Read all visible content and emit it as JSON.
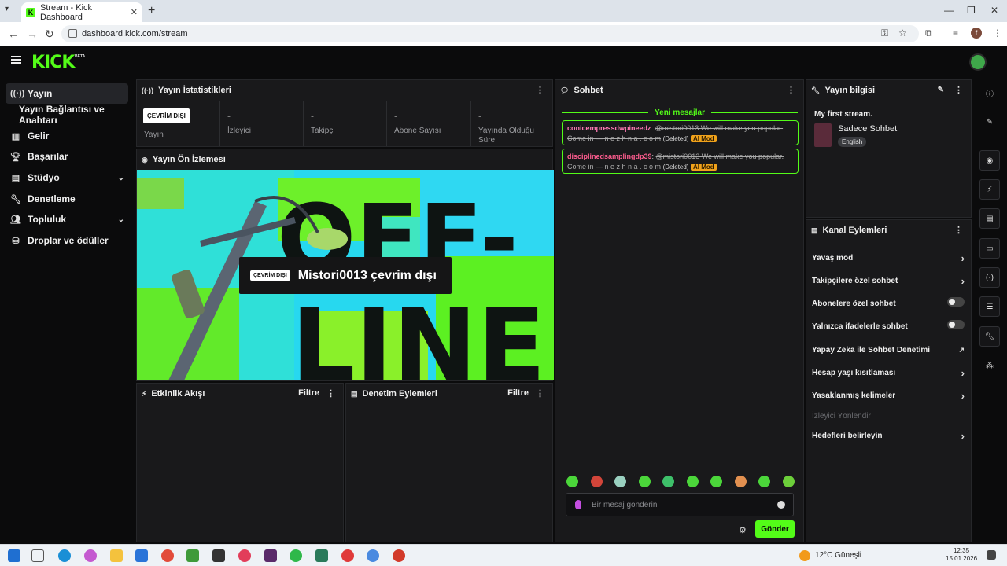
{
  "browser": {
    "tab_title": "Stream - Kick Dashboard",
    "url": "dashboard.kick.com/stream",
    "profile_initial": "f"
  },
  "header": {
    "logo": "KICK",
    "badge": "BETA"
  },
  "sidebar": {
    "items": [
      {
        "label": "Yayın",
        "icon": "broadcast-icon"
      },
      {
        "label": "Yayın Bağlantısı ve Anahtarı",
        "icon": ""
      },
      {
        "label": "Gelir",
        "icon": "chart-icon"
      },
      {
        "label": "Başarılar",
        "icon": "trophy-icon"
      },
      {
        "label": "Stüdyo",
        "icon": "studio-icon"
      },
      {
        "label": "Denetleme",
        "icon": "wrench-icon"
      },
      {
        "label": "Topluluk",
        "icon": "people-icon"
      },
      {
        "label": "Droplar ve ödüller",
        "icon": "gift-icon"
      }
    ]
  },
  "stats": {
    "title": "Yayın İstatistikleri",
    "status_badge": "ÇEVRİM DIŞI",
    "status_label": "Yayın",
    "cells": [
      {
        "value": "-",
        "label": "İzleyici"
      },
      {
        "value": "-",
        "label": "Takipçi"
      },
      {
        "value": "-",
        "label": "Abone Sayısı"
      },
      {
        "value": "-",
        "label": "Yayında Olduğu Süre"
      }
    ]
  },
  "preview": {
    "title": "Yayın Ön İzlemesi",
    "badge": "ÇEVRİM DIŞI",
    "offline_text": "Mistori0013 çevrim dışı",
    "bg_text_1": "OFF-",
    "bg_text_2": "LINE"
  },
  "events": {
    "title": "Etkinlik Akışı",
    "filter": "Filtre"
  },
  "mod_actions": {
    "title": "Denetim Eylemleri",
    "filter": "Filtre"
  },
  "chat": {
    "title": "Sohbet",
    "new_messages": "Yeni mesajlar",
    "messages": [
      {
        "user": "conicempressdwpineedz",
        "text": "@mistori0013 We will make you popular. Come in — n e z h n a . c o m",
        "deleted": "(Deleted)",
        "tag": "AI Mod"
      },
      {
        "user": "disciplinedsamplingdp39",
        "text": "@mistori0013 We will make you popular. Come in — n e z h n a . c o m",
        "deleted": "(Deleted)",
        "tag": "AI Mod"
      }
    ],
    "input_placeholder": "Bir mesaj gönderin",
    "send_label": "Gönder"
  },
  "stream_info": {
    "title": "Yayın bilgisi",
    "stream_title": "My first stream.",
    "category": "Sadece Sohbet",
    "language": "English"
  },
  "channel_actions": {
    "title": "Kanal Eylemleri",
    "items": [
      {
        "label": "Yavaş mod",
        "control": "chevron"
      },
      {
        "label": "Takipçilere özel sohbet",
        "control": "chevron"
      },
      {
        "label": "Abonelere özel sohbet",
        "control": "toggle"
      },
      {
        "label": "Yalnızca ifadelerle sohbet",
        "control": "toggle"
      },
      {
        "label": "Yapay Zeka ile Sohbet Denetimi",
        "control": "external"
      },
      {
        "label": "Hesap yaşı kısıtlaması",
        "control": "chevron"
      },
      {
        "label": "Yasaklanmış kelimeler",
        "control": "chevron"
      },
      {
        "label": "İzleyici Yönlendir",
        "control": "none"
      },
      {
        "label": "Hedefleri belirleyin",
        "control": "chevron"
      }
    ]
  },
  "taskbar": {
    "weather": "12°C Güneşli",
    "time": "12:35",
    "date": "15.01.2026"
  },
  "colors": {
    "accent": "#53fc18",
    "panel": "#19191b",
    "bg": "#0b0b0c",
    "ai_mod": "#f0a21b"
  }
}
